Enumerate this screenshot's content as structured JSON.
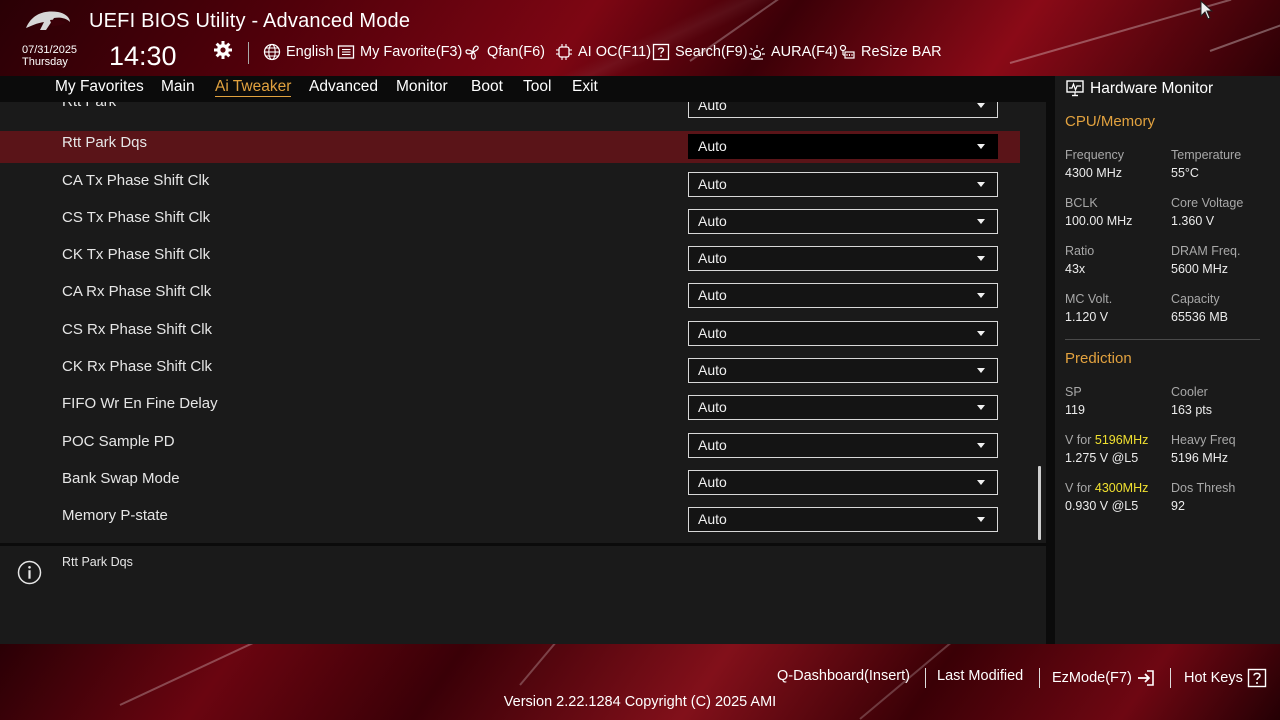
{
  "header": {
    "title": "UEFI BIOS Utility - Advanced Mode",
    "date": "07/31/2025",
    "weekday": "Thursday",
    "time": "14:30",
    "toolbar": [
      {
        "label": "English",
        "icon": "globe-icon"
      },
      {
        "label": "My Favorite(F3)",
        "icon": "favorite-list-icon"
      },
      {
        "label": "Qfan(F6)",
        "icon": "fan-icon"
      },
      {
        "label": "AI OC(F11)",
        "icon": "ai-chip-icon"
      },
      {
        "label": "Search(F9)",
        "icon": "search-help-icon"
      },
      {
        "label": "AURA(F4)",
        "icon": "aura-light-icon"
      },
      {
        "label": "ReSize BAR",
        "icon": "resize-bar-icon"
      }
    ]
  },
  "nav": {
    "tabs": [
      {
        "label": "My Favorites"
      },
      {
        "label": "Main"
      },
      {
        "label": "Ai Tweaker",
        "active": true
      },
      {
        "label": "Advanced"
      },
      {
        "label": "Monitor"
      },
      {
        "label": "Boot"
      },
      {
        "label": "Tool"
      },
      {
        "label": "Exit"
      }
    ]
  },
  "settings": {
    "rows": [
      {
        "label": "Rtt Park",
        "value": "Auto"
      },
      {
        "label": "Rtt Park Dqs",
        "value": "Auto",
        "selected": true
      },
      {
        "label": "CA Tx Phase Shift Clk",
        "value": "Auto"
      },
      {
        "label": "CS Tx Phase Shift Clk",
        "value": "Auto"
      },
      {
        "label": "CK Tx Phase Shift Clk",
        "value": "Auto"
      },
      {
        "label": "CA Rx Phase Shift Clk",
        "value": "Auto"
      },
      {
        "label": "CS Rx Phase Shift Clk",
        "value": "Auto"
      },
      {
        "label": "CK Rx Phase Shift Clk",
        "value": "Auto"
      },
      {
        "label": "FIFO Wr En Fine Delay",
        "value": "Auto"
      },
      {
        "label": "POC Sample PD",
        "value": "Auto"
      },
      {
        "label": "Bank Swap Mode",
        "value": "Auto"
      },
      {
        "label": "Memory P-state",
        "value": "Auto"
      }
    ]
  },
  "info": {
    "text": "Rtt Park Dqs"
  },
  "hardware_monitor": {
    "title": "Hardware Monitor",
    "cpu_memory": {
      "heading": "CPU/Memory",
      "frequency_label": "Frequency",
      "frequency_value": "4300 MHz",
      "temperature_label": "Temperature",
      "temperature_value": "55°C",
      "bclk_label": "BCLK",
      "bclk_value": "100.00 MHz",
      "core_voltage_label": "Core Voltage",
      "core_voltage_value": "1.360 V",
      "ratio_label": "Ratio",
      "ratio_value": "43x",
      "dram_freq_label": "DRAM Freq.",
      "dram_freq_value": "5600 MHz",
      "mc_volt_label": "MC Volt.",
      "mc_volt_value": "1.120 V",
      "capacity_label": "Capacity",
      "capacity_value": "65536 MB"
    },
    "prediction": {
      "heading": "Prediction",
      "sp_label": "SP",
      "sp_value": "119",
      "cooler_label": "Cooler",
      "cooler_value": "163 pts",
      "v_for_1_prefix": "V for ",
      "v_for_1_freq": "5196MHz",
      "v_for_1_value": "1.275 V @L5",
      "heavy_freq_label": "Heavy Freq",
      "heavy_freq_value": "5196 MHz",
      "v_for_2_prefix": "V for ",
      "v_for_2_freq": "4300MHz",
      "v_for_2_value": "0.930 V @L5",
      "dos_thresh_label": "Dos Thresh",
      "dos_thresh_value": "92"
    },
    "highlight_color": "#f0e030"
  },
  "footer": {
    "q_dashboard": "Q-Dashboard(Insert)",
    "last_modified": "Last Modified",
    "ezmode": "EzMode(F7)",
    "hot_keys": "Hot Keys",
    "version": "Version 2.22.1284 Copyright (C) 2025 AMI"
  },
  "colors": {
    "accent": "#e2a23f",
    "selected_row": "#5a1418",
    "panel_bg": "#1a1a1a",
    "header_red": "#7d0613"
  }
}
